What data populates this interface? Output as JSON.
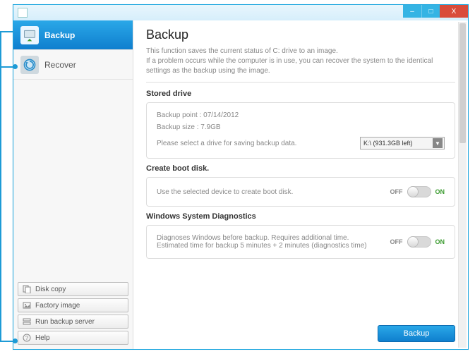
{
  "sidebar": {
    "nav": [
      {
        "label": "Backup",
        "active": true
      },
      {
        "label": "Recover",
        "active": false
      }
    ],
    "bottom": [
      {
        "label": "Disk copy"
      },
      {
        "label": "Factory image"
      },
      {
        "label": "Run backup server"
      },
      {
        "label": "Help"
      }
    ]
  },
  "main": {
    "title": "Backup",
    "desc_line1": "This function saves the current status of C: drive to an image.",
    "desc_line2": "If a problem occurs while the computer is in use, you can recover the system to the identical settings as the backup using the image.",
    "stored_drive": {
      "heading": "Stored drive",
      "backup_point_label": "Backup point : 07/14/2012",
      "backup_size_label": "Backup size : 7.9GB",
      "select_prompt": "Please select a drive for saving backup data.",
      "selected_drive": "K:\\ (931.3GB left)"
    },
    "boot_disk": {
      "heading": "Create boot disk.",
      "text": "Use the selected device to create boot disk.",
      "off": "OFF",
      "on": "ON"
    },
    "diagnostics": {
      "heading": "Windows System Diagnostics",
      "line1": "Diagnoses Windows before backup. Requires additional time.",
      "line2": "Estimated time for backup 5 minutes + 2 minutes (diagnostics time)",
      "off": "OFF",
      "on": "ON"
    },
    "primary_button": "Backup"
  },
  "window_controls": {
    "min": "–",
    "max": "□",
    "close": "X"
  }
}
